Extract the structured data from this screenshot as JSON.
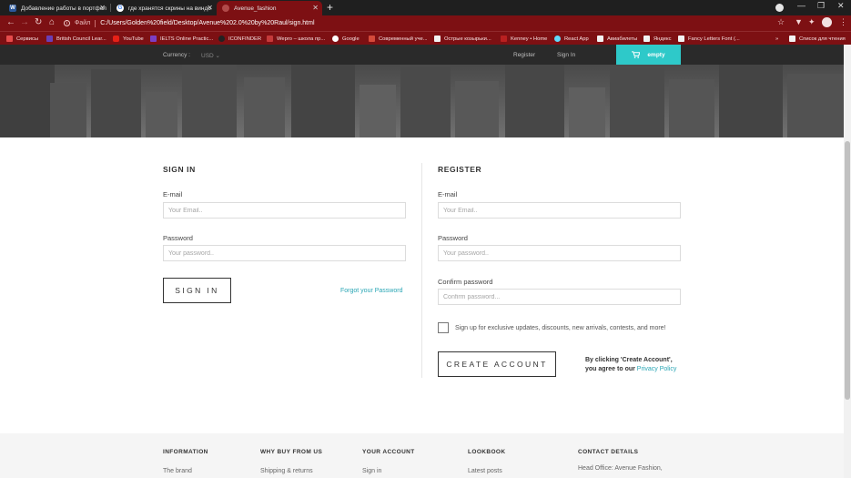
{
  "browser": {
    "tabs": [
      {
        "title": "Добавление работы в портфол",
        "favicon": "W",
        "favicon_color": "#2b579a",
        "active": false
      },
      {
        "title": "где хранятся скрины на виндо",
        "favicon": "G",
        "favicon_color": "#ffffff",
        "active": false
      },
      {
        "title": "Avenue_fashion",
        "favicon": "",
        "favicon_color": "#b14a4a",
        "active": true
      }
    ],
    "address": {
      "file_label": "Файл",
      "url": "C:/Users/Golden%20field/Desktop/Avenue%202.0%20by%20Raul/sign.html"
    },
    "bookmarks": [
      {
        "label": "Сервисы",
        "color": "#e54b4b"
      },
      {
        "label": "British Council Lear...",
        "color": "#6a3fb5"
      },
      {
        "label": "YouTube",
        "color": "#e62117"
      },
      {
        "label": "IELTS Online Practic...",
        "color": "#7b3fc4"
      },
      {
        "label": "ICONFINDER",
        "color": "#222222"
      },
      {
        "label": "Wepro – школа пр...",
        "color": "#c43a3a"
      },
      {
        "label": "Google",
        "color": "#ffffff"
      },
      {
        "label": "Современный уче...",
        "color": "#d44a3a"
      },
      {
        "label": "Острые козырьки...",
        "color": "#f2f2f2"
      },
      {
        "label": "Kenney • Home",
        "color": "#b82020"
      },
      {
        "label": "React App",
        "color": "#61dafb"
      },
      {
        "label": "Авиабилеты",
        "color": "#f2f2f2"
      },
      {
        "label": "Яндекс",
        "color": "#f2f2f2"
      },
      {
        "label": "Fancy Letters Font (...",
        "color": "#f2f2f2"
      },
      {
        "label": "Список для чтения",
        "color": "#f2f2f2"
      }
    ]
  },
  "site_header": {
    "currency_label": "Currency :",
    "currency_value": "USD",
    "register": "Register",
    "sign_in": "Sign In",
    "cart_label": "empty",
    "accent": "#2ec9c9"
  },
  "signin": {
    "title": "SIGN IN",
    "email_label": "E-mail",
    "email_placeholder": "Your Email..",
    "password_label": "Password",
    "password_placeholder": "Your password..",
    "button": "SIGN IN",
    "forgot": "Forgot your Password"
  },
  "register": {
    "title": "REGISTER",
    "email_label": "E-mail",
    "email_placeholder": "Your Email..",
    "password_label": "Password",
    "password_placeholder": "Your password..",
    "confirm_label": "Confirm password",
    "confirm_placeholder": "Confirm password...",
    "newsletter": "Sign up for exclusive updates, discounts, new arrivals, contests, and more!",
    "button": "CREATE ACCOUNT",
    "terms_line1": "By clicking 'Create Account',",
    "terms_line2": "you agree to our",
    "privacy": "Privacy Policy"
  },
  "footer": {
    "columns": [
      {
        "title": "INFORMATION",
        "first_link": "The brand"
      },
      {
        "title": "WHY BUY FROM US",
        "first_link": "Shipping & returns"
      },
      {
        "title": "YOUR ACCOUNT",
        "first_link": "Sign in"
      },
      {
        "title": "LOOKBOOK",
        "first_link": "Latest posts"
      },
      {
        "title": "CONTACT DETAILS",
        "first_link": "Head Office: Avenue Fashion,"
      }
    ]
  }
}
